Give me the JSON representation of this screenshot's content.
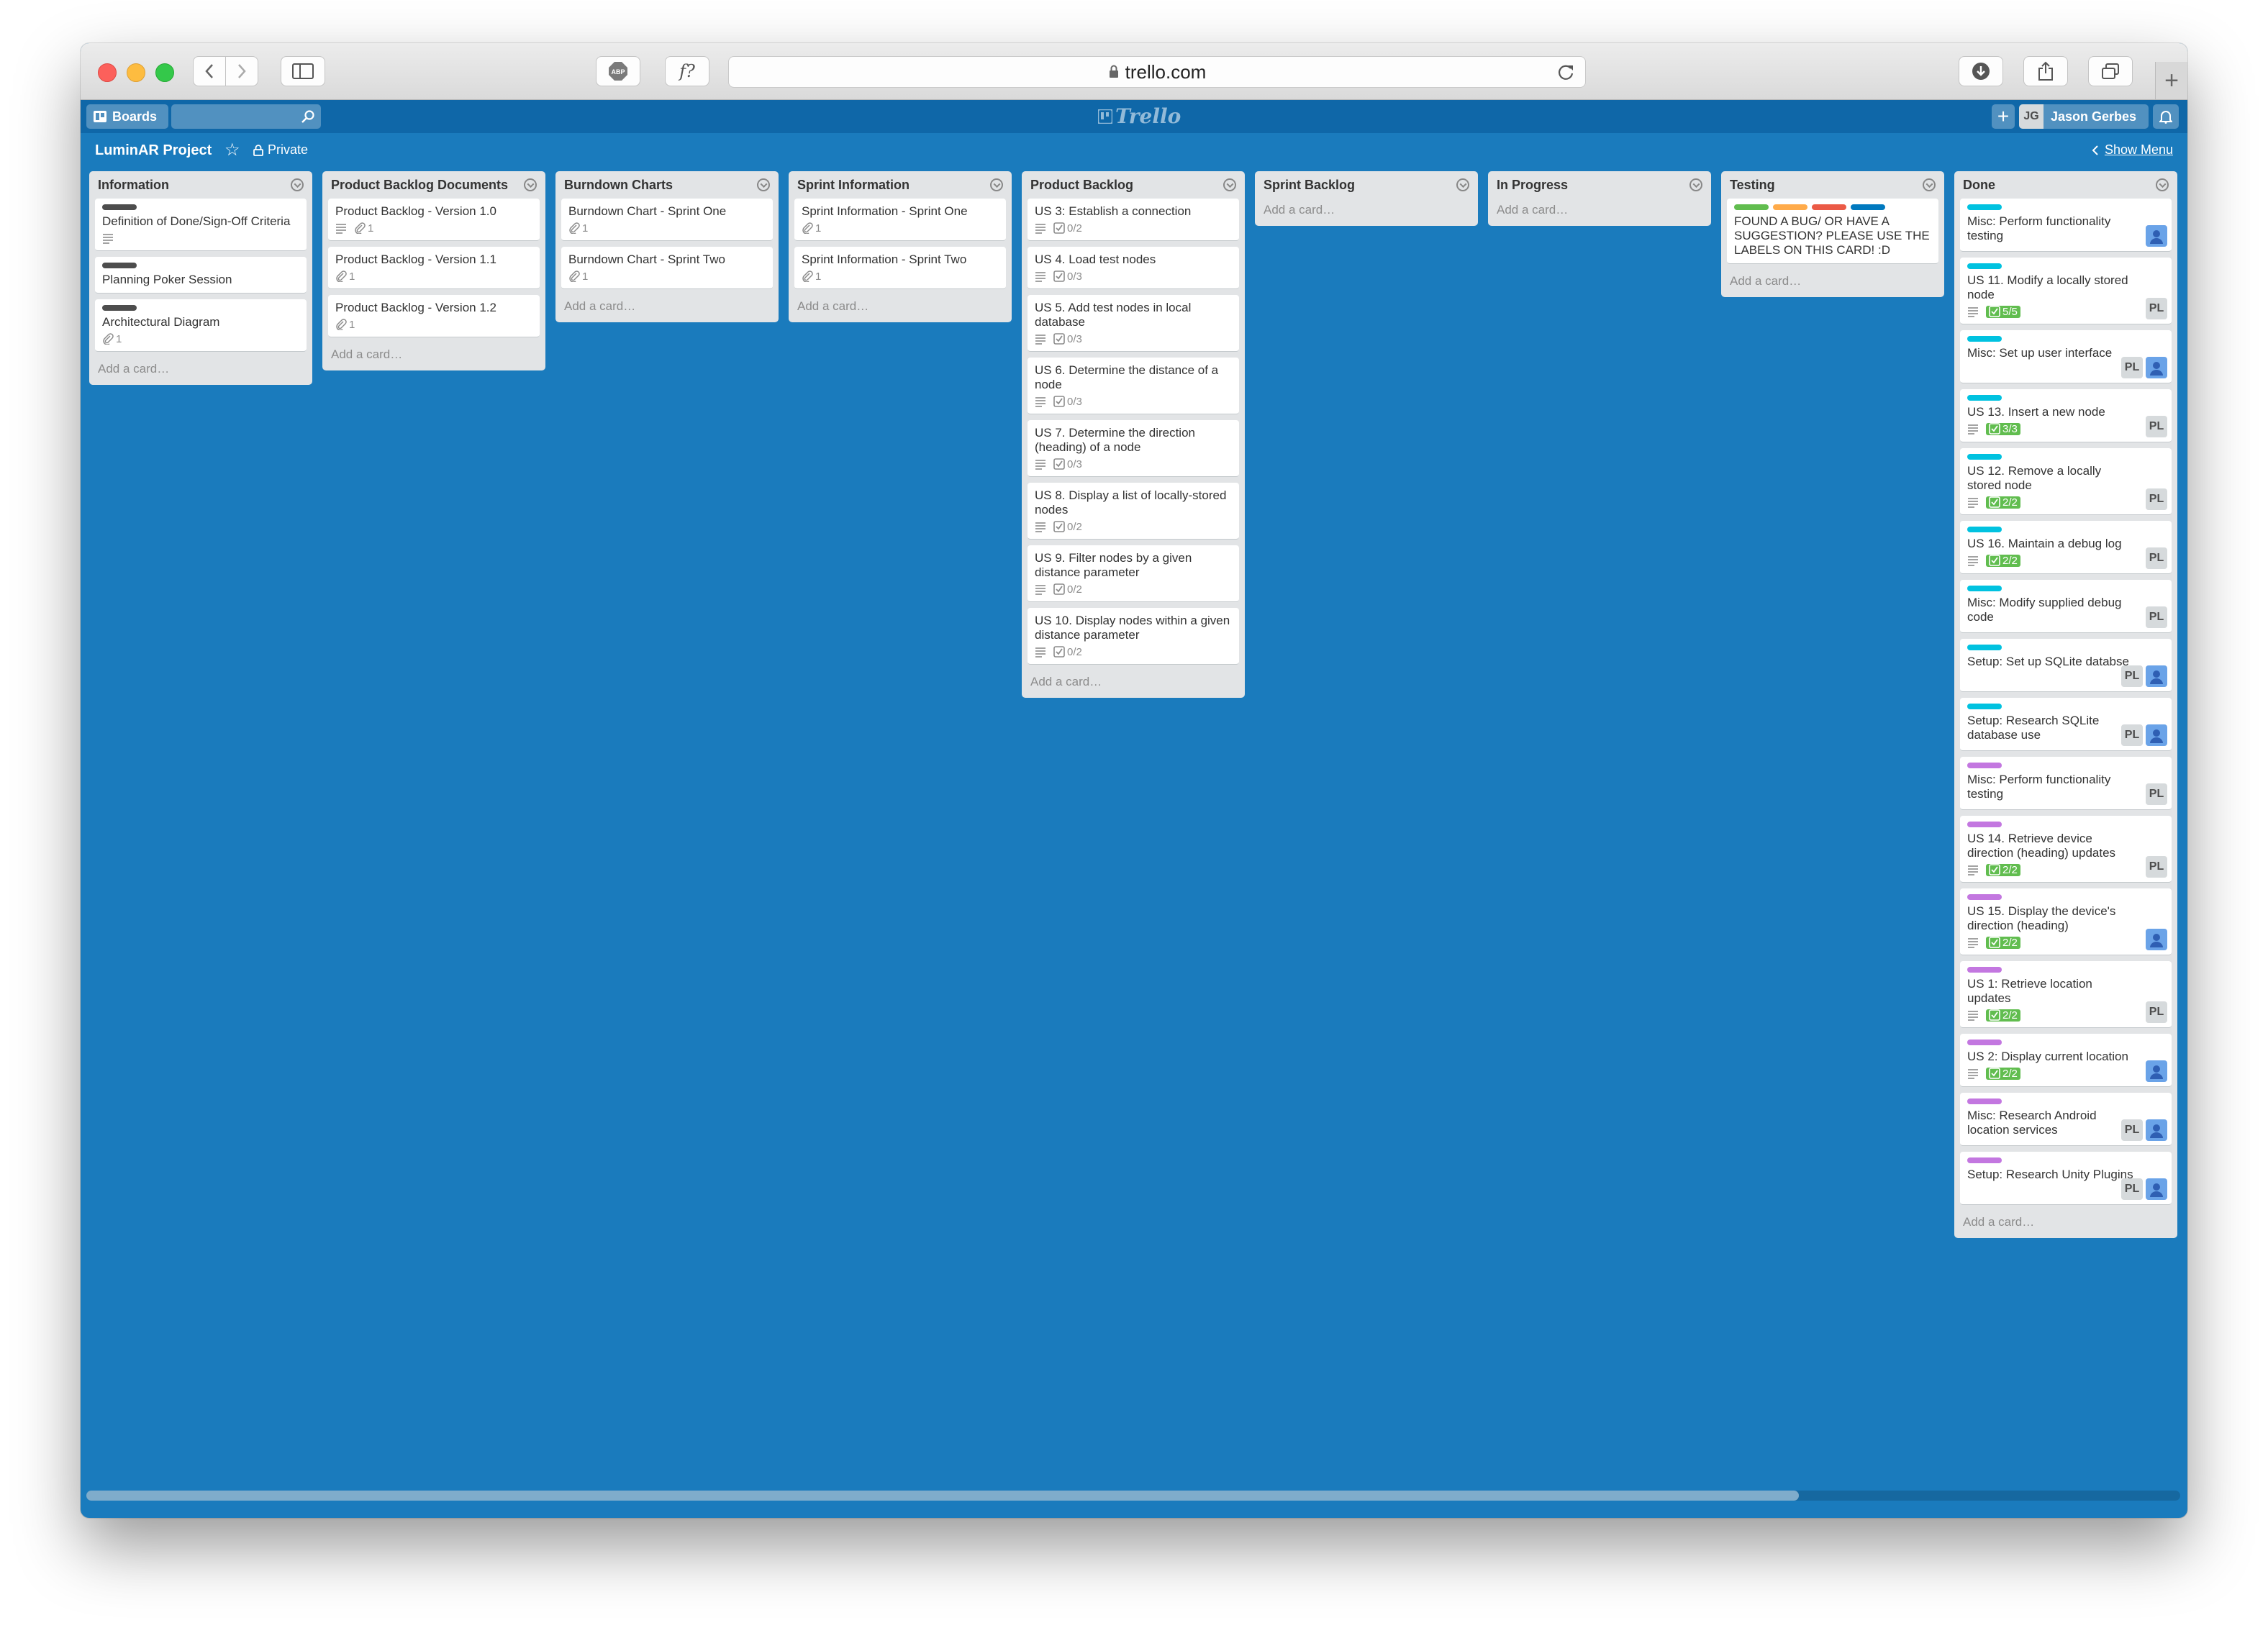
{
  "browser": {
    "url": "trello.com"
  },
  "header": {
    "boards_label": "Boards",
    "logo_text": "Trello",
    "user_initials": "JG",
    "user_name": "Jason Gerbes"
  },
  "board": {
    "title": "LuminAR Project",
    "visibility": "Private",
    "show_menu": "Show Menu"
  },
  "colors": {
    "board_bg": "#1a7bbd",
    "label_black": "#4d4d4d",
    "label_sky": "#00c2e0",
    "label_purple": "#c377e0",
    "label_green": "#61bd4f",
    "label_orange": "#ffab4a",
    "label_red": "#eb5a46",
    "label_blue": "#0079bf"
  },
  "lists": [
    {
      "title": "Information",
      "add": "Add a card…",
      "cards": [
        {
          "title": "Definition of Done/Sign-Off Criteria",
          "labels": [
            "#4d4d4d"
          ],
          "desc": true
        },
        {
          "title": "Planning Poker Session",
          "labels": [
            "#4d4d4d"
          ]
        },
        {
          "title": "Architectural Diagram",
          "labels": [
            "#4d4d4d"
          ],
          "attach": "1"
        }
      ]
    },
    {
      "title": "Product Backlog Documents",
      "add": "Add a card…",
      "cards": [
        {
          "title": "Product Backlog - Version 1.0",
          "desc": true,
          "attach": "1"
        },
        {
          "title": "Product Backlog - Version 1.1",
          "attach": "1"
        },
        {
          "title": "Product Backlog - Version 1.2",
          "attach": "1"
        }
      ]
    },
    {
      "title": "Burndown Charts",
      "add": "Add a card…",
      "cards": [
        {
          "title": "Burndown Chart - Sprint One",
          "attach": "1"
        },
        {
          "title": "Burndown Chart - Sprint Two",
          "attach": "1"
        }
      ]
    },
    {
      "title": "Sprint Information",
      "add": "Add a card…",
      "cards": [
        {
          "title": "Sprint Information - Sprint One",
          "attach": "1"
        },
        {
          "title": "Sprint Information - Sprint Two",
          "attach": "1"
        }
      ]
    },
    {
      "title": "Product Backlog",
      "add": "Add a card…",
      "cards": [
        {
          "title": "US 3: Establish a connection",
          "desc": true,
          "check": "0/2"
        },
        {
          "title": "US 4. Load test nodes",
          "desc": true,
          "check": "0/3"
        },
        {
          "title": "US 5. Add test nodes in local database",
          "desc": true,
          "check": "0/3"
        },
        {
          "title": "US 6. Determine the distance of a node",
          "desc": true,
          "check": "0/3"
        },
        {
          "title": "US 7. Determine the direction (heading) of a node",
          "desc": true,
          "check": "0/3"
        },
        {
          "title": "US 8. Display a list of locally-stored nodes",
          "desc": true,
          "check": "0/2"
        },
        {
          "title": "US 9. Filter nodes by a given distance parameter",
          "desc": true,
          "check": "0/2"
        },
        {
          "title": "US 10. Display nodes within a given distance parameter",
          "desc": true,
          "check": "0/2"
        }
      ]
    },
    {
      "title": "Sprint Backlog",
      "add": "Add a card…",
      "cards": []
    },
    {
      "title": "In Progress",
      "add": "Add a card…",
      "cards": []
    },
    {
      "title": "Testing",
      "add": "Add a card…",
      "cards": [
        {
          "title": "FOUND A BUG/ OR HAVE A SUGGESTION? PLEASE USE THE LABELS ON THIS CARD! :D",
          "labels": [
            "#61bd4f",
            "#ffab4a",
            "#eb5a46",
            "#0079bf"
          ]
        }
      ]
    },
    {
      "title": "Done",
      "add": "Add a card…",
      "cards": [
        {
          "title": "Misc: Perform functionality testing",
          "labels": [
            "#00c2e0"
          ],
          "members": [
            "photo"
          ]
        },
        {
          "title": "US 11. Modify a locally stored node",
          "labels": [
            "#00c2e0"
          ],
          "desc": true,
          "check": "5/5",
          "check_done": true,
          "members": [
            "PL"
          ]
        },
        {
          "title": "Misc: Set up user interface",
          "labels": [
            "#00c2e0"
          ],
          "members": [
            "PL",
            "photo"
          ]
        },
        {
          "title": "US 13. Insert a new node",
          "labels": [
            "#00c2e0"
          ],
          "desc": true,
          "check": "3/3",
          "check_done": true,
          "members": [
            "PL"
          ]
        },
        {
          "title": "US 12. Remove a locally stored node",
          "labels": [
            "#00c2e0"
          ],
          "desc": true,
          "check": "2/2",
          "check_done": true,
          "members": [
            "PL"
          ]
        },
        {
          "title": "US 16. Maintain a debug log",
          "labels": [
            "#00c2e0"
          ],
          "desc": true,
          "check": "2/2",
          "check_done": true,
          "members": [
            "PL"
          ]
        },
        {
          "title": "Misc: Modify supplied debug code",
          "labels": [
            "#00c2e0"
          ],
          "members": [
            "PL"
          ]
        },
        {
          "title": "Setup: Set up SQLite databse",
          "labels": [
            "#00c2e0"
          ],
          "members": [
            "PL",
            "photo"
          ]
        },
        {
          "title": "Setup: Research SQLite database use",
          "labels": [
            "#00c2e0"
          ],
          "members": [
            "PL",
            "photo"
          ]
        },
        {
          "title": "Misc: Perform functionality testing",
          "labels": [
            "#c377e0"
          ],
          "members": [
            "PL"
          ]
        },
        {
          "title": "US 14. Retrieve device direction (heading) updates",
          "labels": [
            "#c377e0"
          ],
          "desc": true,
          "check": "2/2",
          "check_done": true,
          "members": [
            "PL"
          ]
        },
        {
          "title": "US 15. Display the device's direction (heading)",
          "labels": [
            "#c377e0"
          ],
          "desc": true,
          "check": "2/2",
          "check_done": true,
          "members": [
            "photo"
          ]
        },
        {
          "title": "US 1: Retrieve location updates",
          "labels": [
            "#c377e0"
          ],
          "desc": true,
          "check": "2/2",
          "check_done": true,
          "members": [
            "PL"
          ]
        },
        {
          "title": "US 2: Display current location",
          "labels": [
            "#c377e0"
          ],
          "desc": true,
          "check": "2/2",
          "check_done": true,
          "members": [
            "photo"
          ]
        },
        {
          "title": "Misc: Research Android location services",
          "labels": [
            "#c377e0"
          ],
          "members": [
            "PL",
            "photo"
          ]
        },
        {
          "title": "Setup: Research Unity Plugins",
          "labels": [
            "#c377e0"
          ],
          "members": [
            "PL",
            "photo"
          ]
        }
      ]
    }
  ]
}
